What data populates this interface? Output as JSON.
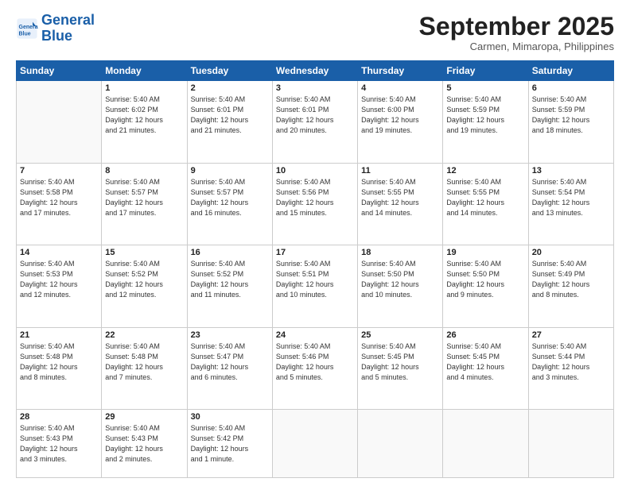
{
  "logo": {
    "line1": "General",
    "line2": "Blue"
  },
  "title": "September 2025",
  "location": "Carmen, Mimaropa, Philippines",
  "days_of_week": [
    "Sunday",
    "Monday",
    "Tuesday",
    "Wednesday",
    "Thursday",
    "Friday",
    "Saturday"
  ],
  "weeks": [
    [
      {
        "day": "",
        "info": ""
      },
      {
        "day": "1",
        "info": "Sunrise: 5:40 AM\nSunset: 6:02 PM\nDaylight: 12 hours\nand 21 minutes."
      },
      {
        "day": "2",
        "info": "Sunrise: 5:40 AM\nSunset: 6:01 PM\nDaylight: 12 hours\nand 21 minutes."
      },
      {
        "day": "3",
        "info": "Sunrise: 5:40 AM\nSunset: 6:01 PM\nDaylight: 12 hours\nand 20 minutes."
      },
      {
        "day": "4",
        "info": "Sunrise: 5:40 AM\nSunset: 6:00 PM\nDaylight: 12 hours\nand 19 minutes."
      },
      {
        "day": "5",
        "info": "Sunrise: 5:40 AM\nSunset: 5:59 PM\nDaylight: 12 hours\nand 19 minutes."
      },
      {
        "day": "6",
        "info": "Sunrise: 5:40 AM\nSunset: 5:59 PM\nDaylight: 12 hours\nand 18 minutes."
      }
    ],
    [
      {
        "day": "7",
        "info": "Sunrise: 5:40 AM\nSunset: 5:58 PM\nDaylight: 12 hours\nand 17 minutes."
      },
      {
        "day": "8",
        "info": "Sunrise: 5:40 AM\nSunset: 5:57 PM\nDaylight: 12 hours\nand 17 minutes."
      },
      {
        "day": "9",
        "info": "Sunrise: 5:40 AM\nSunset: 5:57 PM\nDaylight: 12 hours\nand 16 minutes."
      },
      {
        "day": "10",
        "info": "Sunrise: 5:40 AM\nSunset: 5:56 PM\nDaylight: 12 hours\nand 15 minutes."
      },
      {
        "day": "11",
        "info": "Sunrise: 5:40 AM\nSunset: 5:55 PM\nDaylight: 12 hours\nand 14 minutes."
      },
      {
        "day": "12",
        "info": "Sunrise: 5:40 AM\nSunset: 5:55 PM\nDaylight: 12 hours\nand 14 minutes."
      },
      {
        "day": "13",
        "info": "Sunrise: 5:40 AM\nSunset: 5:54 PM\nDaylight: 12 hours\nand 13 minutes."
      }
    ],
    [
      {
        "day": "14",
        "info": "Sunrise: 5:40 AM\nSunset: 5:53 PM\nDaylight: 12 hours\nand 12 minutes."
      },
      {
        "day": "15",
        "info": "Sunrise: 5:40 AM\nSunset: 5:52 PM\nDaylight: 12 hours\nand 12 minutes."
      },
      {
        "day": "16",
        "info": "Sunrise: 5:40 AM\nSunset: 5:52 PM\nDaylight: 12 hours\nand 11 minutes."
      },
      {
        "day": "17",
        "info": "Sunrise: 5:40 AM\nSunset: 5:51 PM\nDaylight: 12 hours\nand 10 minutes."
      },
      {
        "day": "18",
        "info": "Sunrise: 5:40 AM\nSunset: 5:50 PM\nDaylight: 12 hours\nand 10 minutes."
      },
      {
        "day": "19",
        "info": "Sunrise: 5:40 AM\nSunset: 5:50 PM\nDaylight: 12 hours\nand 9 minutes."
      },
      {
        "day": "20",
        "info": "Sunrise: 5:40 AM\nSunset: 5:49 PM\nDaylight: 12 hours\nand 8 minutes."
      }
    ],
    [
      {
        "day": "21",
        "info": "Sunrise: 5:40 AM\nSunset: 5:48 PM\nDaylight: 12 hours\nand 8 minutes."
      },
      {
        "day": "22",
        "info": "Sunrise: 5:40 AM\nSunset: 5:48 PM\nDaylight: 12 hours\nand 7 minutes."
      },
      {
        "day": "23",
        "info": "Sunrise: 5:40 AM\nSunset: 5:47 PM\nDaylight: 12 hours\nand 6 minutes."
      },
      {
        "day": "24",
        "info": "Sunrise: 5:40 AM\nSunset: 5:46 PM\nDaylight: 12 hours\nand 5 minutes."
      },
      {
        "day": "25",
        "info": "Sunrise: 5:40 AM\nSunset: 5:45 PM\nDaylight: 12 hours\nand 5 minutes."
      },
      {
        "day": "26",
        "info": "Sunrise: 5:40 AM\nSunset: 5:45 PM\nDaylight: 12 hours\nand 4 minutes."
      },
      {
        "day": "27",
        "info": "Sunrise: 5:40 AM\nSunset: 5:44 PM\nDaylight: 12 hours\nand 3 minutes."
      }
    ],
    [
      {
        "day": "28",
        "info": "Sunrise: 5:40 AM\nSunset: 5:43 PM\nDaylight: 12 hours\nand 3 minutes."
      },
      {
        "day": "29",
        "info": "Sunrise: 5:40 AM\nSunset: 5:43 PM\nDaylight: 12 hours\nand 2 minutes."
      },
      {
        "day": "30",
        "info": "Sunrise: 5:40 AM\nSunset: 5:42 PM\nDaylight: 12 hours\nand 1 minute."
      },
      {
        "day": "",
        "info": ""
      },
      {
        "day": "",
        "info": ""
      },
      {
        "day": "",
        "info": ""
      },
      {
        "day": "",
        "info": ""
      }
    ]
  ]
}
